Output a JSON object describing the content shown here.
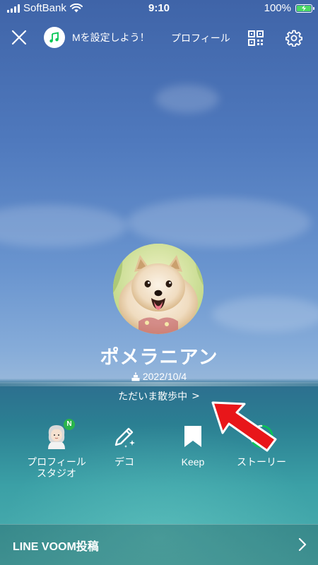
{
  "status_bar": {
    "carrier": "SoftBank",
    "time": "9:10",
    "battery_percent": "100%"
  },
  "header": {
    "music_prompt": "Mを設定しよう！",
    "profile_link": "プロフィール",
    "icons": [
      "close-icon",
      "music-note-icon",
      "qr-code-icon",
      "gear-icon"
    ]
  },
  "profile": {
    "name": "ポメラニアン",
    "birthday": "2022/10/4",
    "status_message": "ただいま散歩中",
    "status_chevron": ">"
  },
  "actions": [
    {
      "label_line1": "プロフィール",
      "label_line2": "スタジオ",
      "icon": "avatar-studio-icon",
      "badge": "N"
    },
    {
      "label_line1": "デコ",
      "icon": "pen-sparkle-icon"
    },
    {
      "label_line1": "Keep",
      "icon": "bookmark-icon"
    },
    {
      "label_line1": "ストーリー",
      "icon": "story-ring-icon"
    }
  ],
  "voom": {
    "label": "LINE VOOM投稿"
  },
  "colors": {
    "line_green": "#06c755",
    "badge_green": "#2ab54b",
    "arrow_red": "#e8161a",
    "battery_green": "#4cd964"
  }
}
